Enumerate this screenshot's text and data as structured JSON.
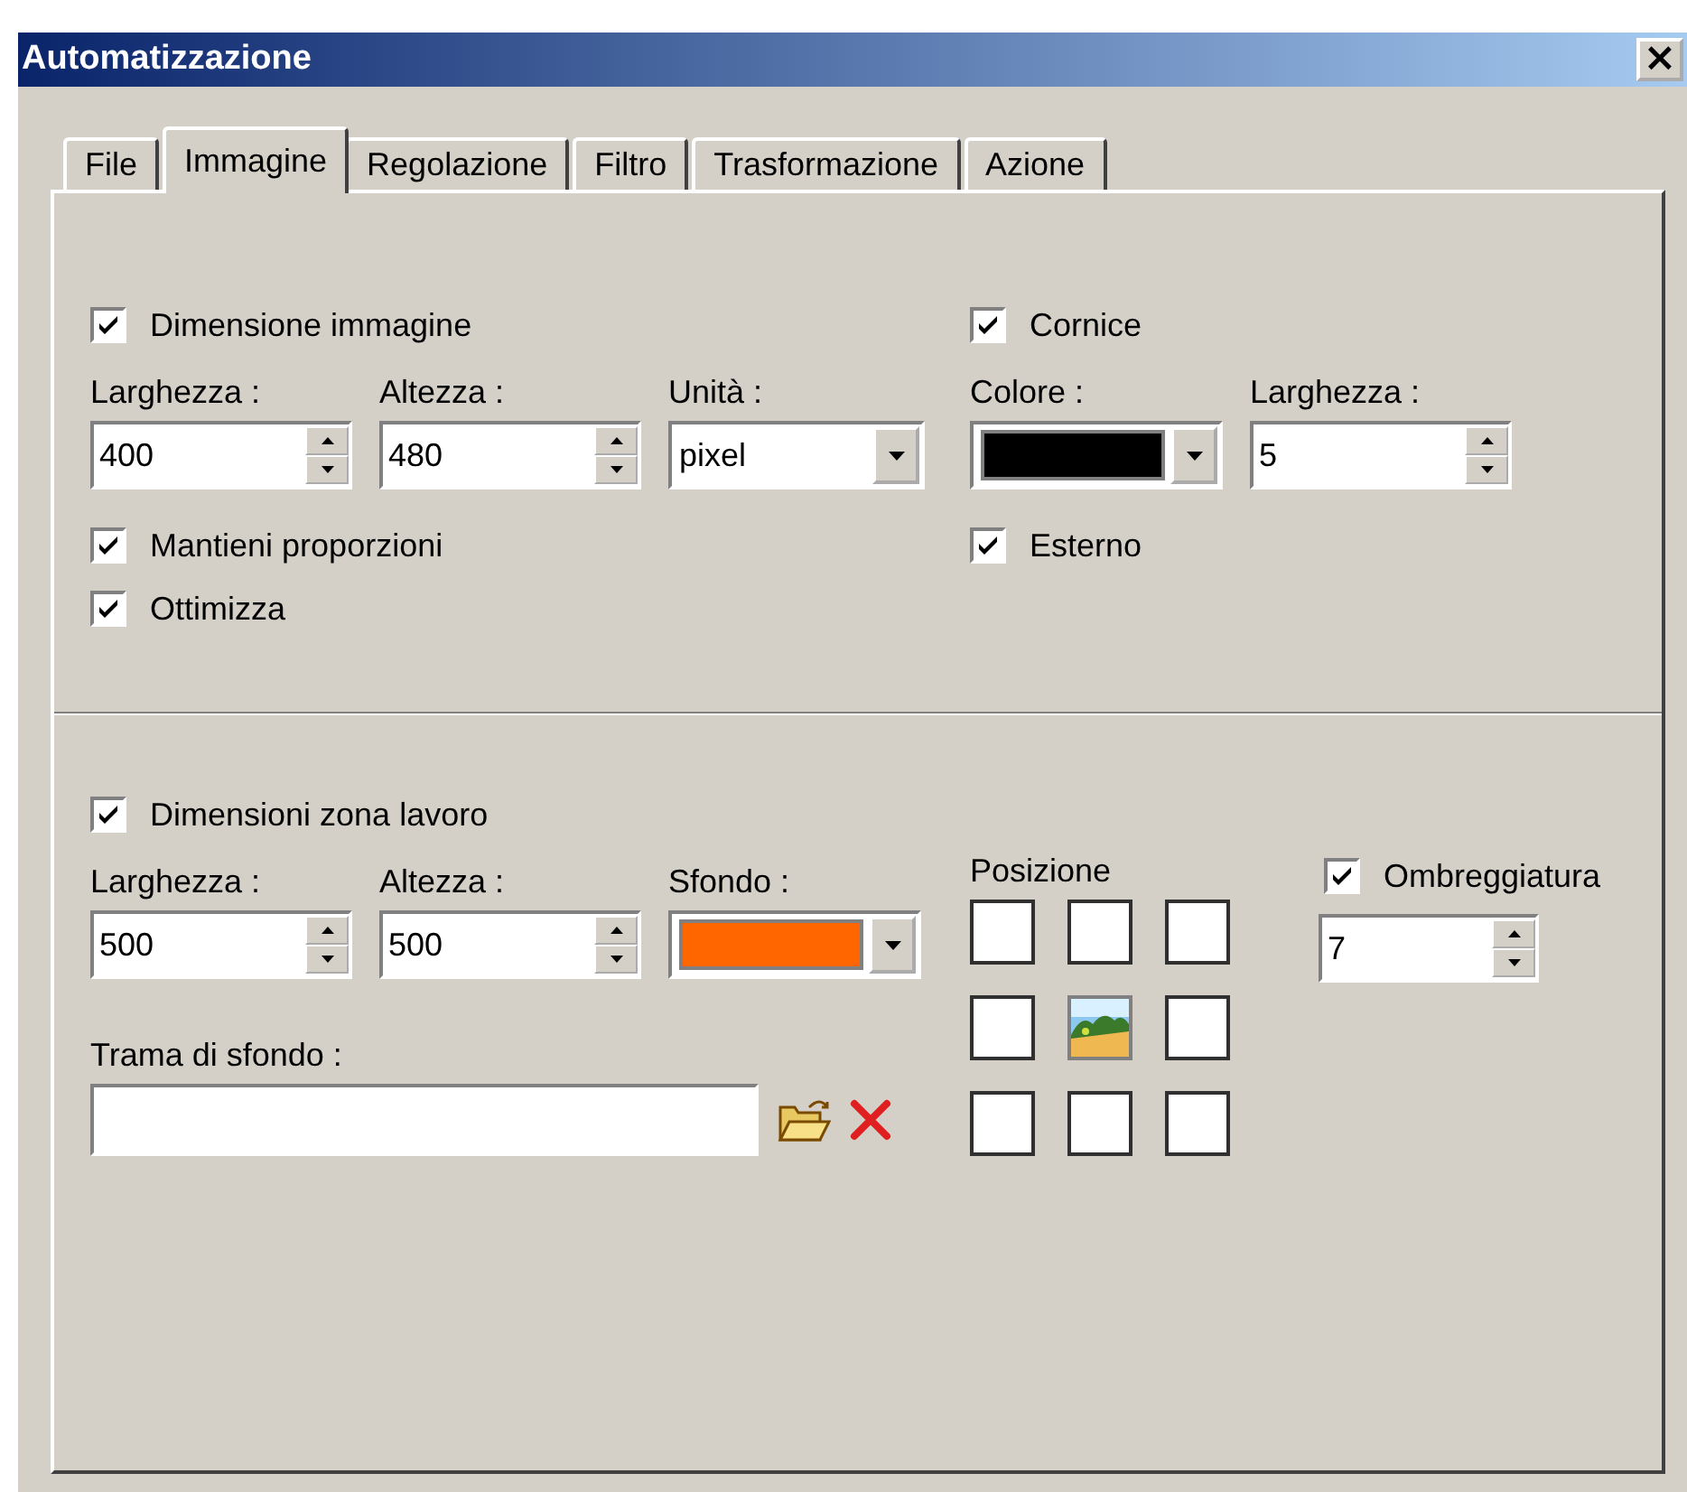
{
  "window": {
    "title": "Automatizzazione",
    "close": "×"
  },
  "tabs": [
    {
      "label": "File",
      "selected": false
    },
    {
      "label": "Immagine",
      "selected": true
    },
    {
      "label": "Regolazione",
      "selected": false
    },
    {
      "label": "Filtro",
      "selected": false
    },
    {
      "label": "Trasformazione",
      "selected": false
    },
    {
      "label": "Azione",
      "selected": false
    }
  ],
  "image_size": {
    "label": "Dimensione immagine",
    "checked": true,
    "fields": [
      {
        "kind": "spin",
        "label": "Larghezza :",
        "value": "400"
      },
      {
        "kind": "spin",
        "label": "Altezza :",
        "value": "480"
      },
      {
        "kind": "combo",
        "label": "Unità :",
        "value": "pixel"
      }
    ],
    "options": [
      {
        "label": "Mantieni proporzioni",
        "checked": true
      },
      {
        "label": "Ottimizza",
        "checked": true
      }
    ]
  },
  "frame": {
    "label": "Cornice",
    "checked": true,
    "fields": [
      {
        "kind": "color",
        "label": "Colore :",
        "color": "#000000"
      },
      {
        "kind": "spin",
        "label": "Larghezza :",
        "value": "5"
      }
    ],
    "options": [
      {
        "label": "Esterno",
        "checked": true
      }
    ]
  },
  "canvas_size": {
    "label": "Dimensioni zona lavoro",
    "checked": true,
    "fields": [
      {
        "kind": "spin",
        "label": "Larghezza :",
        "value": "500"
      },
      {
        "kind": "spin",
        "label": "Altezza :",
        "value": "500"
      },
      {
        "kind": "color",
        "label": "Sfondo :",
        "color": "#ff6600"
      }
    ],
    "texture": {
      "label": "Trama di sfondo :"
    }
  },
  "position": {
    "label": "Posizione",
    "cells": [
      {
        "selected": false
      },
      {
        "selected": false
      },
      {
        "selected": false
      },
      {
        "selected": false
      },
      {
        "selected": true
      },
      {
        "selected": false
      },
      {
        "selected": false
      },
      {
        "selected": false
      },
      {
        "selected": false
      }
    ]
  },
  "shadow": {
    "label": "Ombreggiatura",
    "checked": true,
    "value": "7"
  }
}
